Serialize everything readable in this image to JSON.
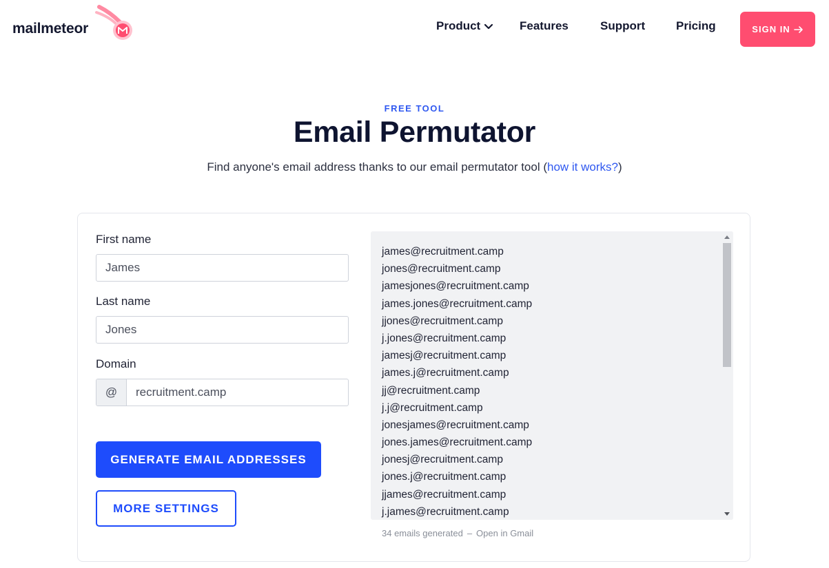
{
  "header": {
    "logo_text": "mailmeteor",
    "nav": {
      "product": "Product",
      "features": "Features",
      "support": "Support",
      "pricing": "Pricing"
    },
    "signin_label": "SIGN IN",
    "brand_color": "#ff4d70"
  },
  "hero": {
    "eyebrow": "FREE TOOL",
    "title": "Email Permutator",
    "subtitle_before": "Find anyone's email address thanks to our email permutator tool (",
    "subtitle_link": "how it works?",
    "subtitle_after": ")"
  },
  "form": {
    "first_name_label": "First name",
    "first_name_value": "James",
    "last_name_label": "Last name",
    "last_name_value": "Jones",
    "domain_label": "Domain",
    "domain_prefix": "@",
    "domain_value": "recruitment.camp",
    "generate_label": "GENERATE EMAIL ADDRESSES",
    "more_settings_label": "MORE SETTINGS",
    "accent_color": "#1e4cfc"
  },
  "results": {
    "emails": [
      "james@recruitment.camp",
      "jones@recruitment.camp",
      "jamesjones@recruitment.camp",
      "james.jones@recruitment.camp",
      "jjones@recruitment.camp",
      "j.jones@recruitment.camp",
      "jamesj@recruitment.camp",
      "james.j@recruitment.camp",
      "jj@recruitment.camp",
      "j.j@recruitment.camp",
      "jonesjames@recruitment.camp",
      "jones.james@recruitment.camp",
      "jonesj@recruitment.camp",
      "jones.j@recruitment.camp",
      "jjames@recruitment.camp",
      "j.james@recruitment.camp"
    ],
    "count_text": "34 emails generated",
    "separator": "–",
    "open_gmail": "Open in Gmail"
  }
}
